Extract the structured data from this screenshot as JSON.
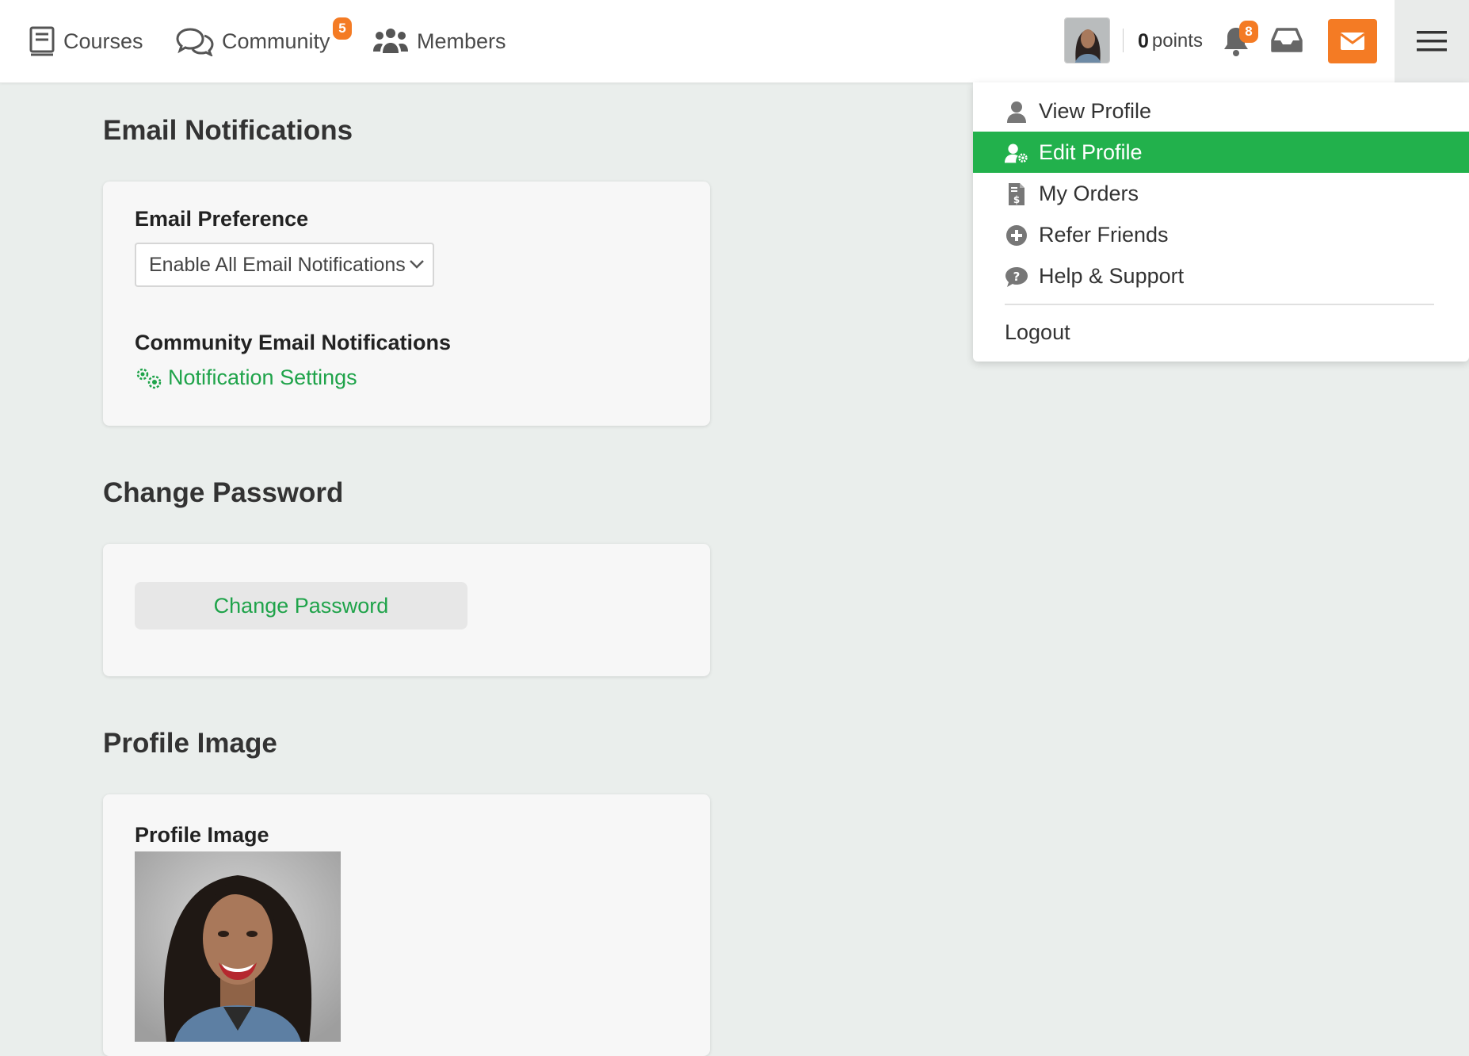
{
  "nav": {
    "courses": "Courses",
    "community": "Community",
    "community_badge": "5",
    "members": "Members"
  },
  "header": {
    "points_value": "0",
    "points_label": "points",
    "notifications_badge": "8"
  },
  "email_section": {
    "title": "Email Notifications",
    "preference_label": "Email Preference",
    "preference_value": "Enable All Email Notifications",
    "community_label": "Community Email Notifications",
    "settings_link": "Notification Settings"
  },
  "password_section": {
    "title": "Change Password",
    "button": "Change Password"
  },
  "profile_section": {
    "title": "Profile Image",
    "label": "Profile Image"
  },
  "dropdown": {
    "items": [
      {
        "label": "View Profile",
        "icon": "user-icon"
      },
      {
        "label": "Edit Profile",
        "icon": "user-cog-icon",
        "active": true
      },
      {
        "label": "My Orders",
        "icon": "invoice-icon"
      },
      {
        "label": "Refer Friends",
        "icon": "plus-circle-icon"
      },
      {
        "label": "Help & Support",
        "icon": "help-chat-icon"
      }
    ],
    "logout": "Logout"
  },
  "colors": {
    "accent_green": "#22b14c",
    "link_green": "#1fa34a",
    "orange": "#f47b24"
  }
}
